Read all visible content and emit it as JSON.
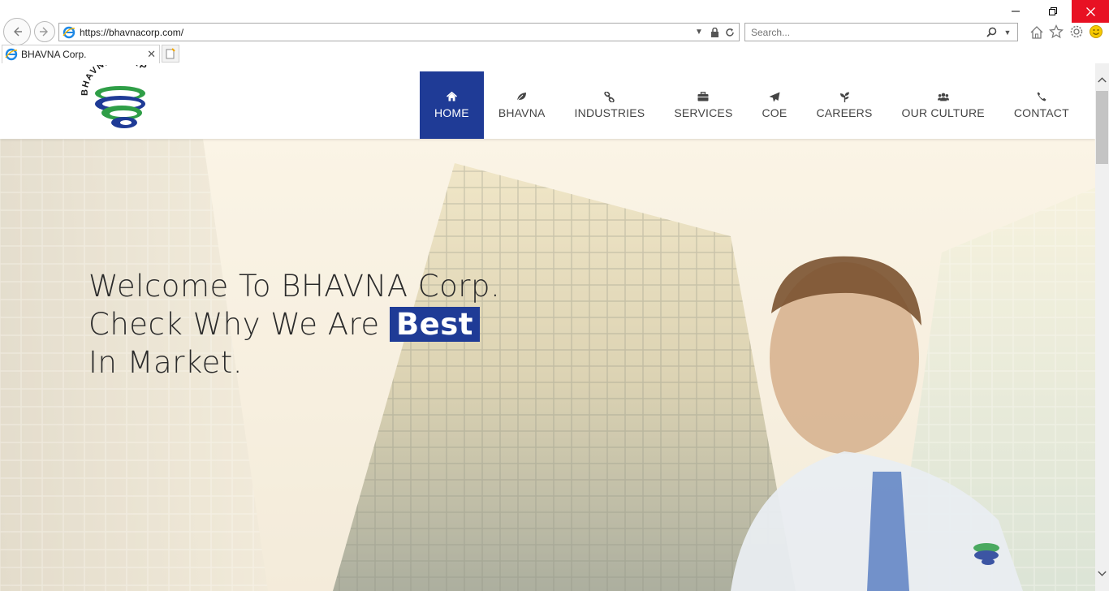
{
  "browser": {
    "address_url": "https://bhavnacorp.com/",
    "search_placeholder": "Search...",
    "tab_title": "BHAVNA Corp."
  },
  "site": {
    "logo_text": "BHAVNA CORP",
    "menu": [
      {
        "label": "HOME",
        "icon": "home-icon",
        "active": true
      },
      {
        "label": "BHAVNA",
        "icon": "leaf-icon"
      },
      {
        "label": "INDUSTRIES",
        "icon": "link-icon"
      },
      {
        "label": "SERVICES",
        "icon": "briefcase-icon"
      },
      {
        "label": "COE",
        "icon": "paper-plane-icon"
      },
      {
        "label": "CAREERS",
        "icon": "plant-icon"
      },
      {
        "label": "OUR CULTURE",
        "icon": "users-icon"
      },
      {
        "label": "CONTACT",
        "icon": "phone-icon"
      }
    ],
    "hero": {
      "line1": "Welcome To BHAVNA Corp.",
      "line2_pre": "Check Why We Are",
      "line2_highlight": "Best",
      "line3": "In Market."
    },
    "accent_color": "#1f3b96"
  }
}
